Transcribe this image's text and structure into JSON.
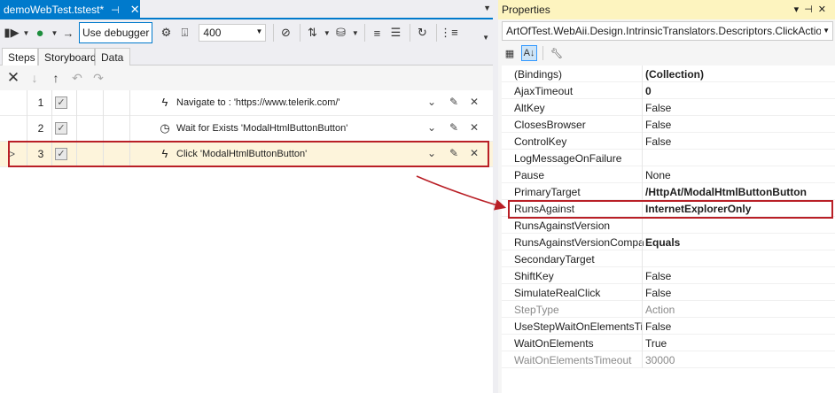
{
  "document_tab": {
    "title": "demoWebTest.tstest*",
    "pin_icon": "pin-icon",
    "close_icon": "close-icon"
  },
  "toolbar": {
    "use_debugger_label": "Use debugger",
    "delay_value": "400",
    "icons": [
      "record-icon",
      "run-icon",
      "settings-icon",
      "export-icon",
      "stopwatch-icon",
      "compare-icon",
      "database-icon",
      "format-icon",
      "sort-icon",
      "refresh-icon",
      "list-icon"
    ]
  },
  "subtabs": [
    "Steps",
    "Storyboard",
    "Data"
  ],
  "step_toolbar": {
    "icons": [
      "delete-icon",
      "move-down-icon",
      "move-up-icon",
      "undo-icon",
      "redo-icon"
    ]
  },
  "steps": [
    {
      "num": "1",
      "checked": true,
      "icon": "lightning-icon",
      "description": "Navigate to : 'https://www.telerik.com/'"
    },
    {
      "num": "2",
      "checked": true,
      "icon": "clock-icon",
      "description": "Wait for Exists 'ModalHtmlButtonButton'"
    },
    {
      "num": "3",
      "checked": true,
      "icon": "lightning-icon",
      "description": "Click 'ModalHtmlButtonButton'",
      "selected": true
    }
  ],
  "properties": {
    "title": "Properties",
    "object": "ArtOfTest.WebAii.Design.IntrinsicTranslators.Descriptors.ClickAction",
    "rows": [
      {
        "name": "(Bindings)",
        "value": "(Collection)",
        "bold": true
      },
      {
        "name": "AjaxTimeout",
        "value": "0",
        "bold": true
      },
      {
        "name": "AltKey",
        "value": "False"
      },
      {
        "name": "ClosesBrowser",
        "value": "False"
      },
      {
        "name": "ControlKey",
        "value": "False"
      },
      {
        "name": "LogMessageOnFailure",
        "value": ""
      },
      {
        "name": "Pause",
        "value": "None"
      },
      {
        "name": "PrimaryTarget",
        "value": "/HttpAt/ModalHtmlButtonButton",
        "bold": true
      },
      {
        "name": "RunsAgainst",
        "value": "InternetExplorerOnly",
        "bold": true,
        "highlight": true
      },
      {
        "name": "RunsAgainstVersion",
        "value": ""
      },
      {
        "name": "RunsAgainstVersionCompa",
        "value": "Equals",
        "bold": true
      },
      {
        "name": "SecondaryTarget",
        "value": ""
      },
      {
        "name": "ShiftKey",
        "value": "False"
      },
      {
        "name": "SimulateRealClick",
        "value": "False"
      },
      {
        "name": "StepType",
        "value": "Action",
        "readonly": true
      },
      {
        "name": "UseStepWaitOnElementsTir",
        "value": "False"
      },
      {
        "name": "WaitOnElements",
        "value": "True"
      },
      {
        "name": "WaitOnElementsTimeout",
        "value": "30000",
        "readonly": true
      }
    ]
  },
  "colors": {
    "accent": "#007acc",
    "highlight_border": "#b91f26",
    "selected_row": "#fdf4db",
    "properties_header": "#fdf4bf"
  }
}
